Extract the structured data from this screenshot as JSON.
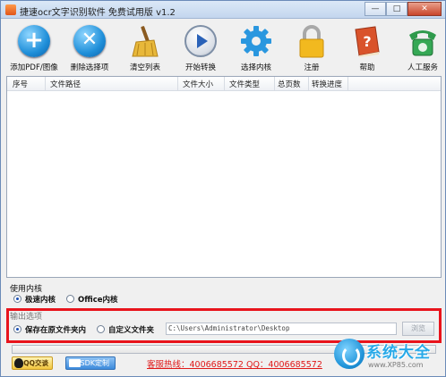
{
  "window": {
    "title": "捷速ocr文字识别软件 免费试用版 v1.2",
    "minimize_label": "—",
    "maximize_label": "□",
    "close_label": "✕"
  },
  "toolbar": {
    "items": [
      {
        "label": "添加PDF/图像",
        "icon": "add-icon",
        "color": "#1f8fd9"
      },
      {
        "label": "删除选择项",
        "icon": "delete-icon",
        "color": "#1f8fd9"
      },
      {
        "label": "清空列表",
        "icon": "broom-icon",
        "color": "#d4a12a"
      },
      {
        "label": "开始转换",
        "icon": "play-icon",
        "color": "#2a62b8"
      },
      {
        "label": "选择内核",
        "icon": "gear-icon",
        "color": "#1f8fd9"
      },
      {
        "label": "注册",
        "icon": "lock-icon",
        "color": "#f0b820"
      },
      {
        "label": "帮助",
        "icon": "help-book-icon",
        "color": "#d9532b"
      },
      {
        "label": "人工服务",
        "icon": "phone-icon",
        "color": "#2f9a4c"
      }
    ]
  },
  "table": {
    "columns": [
      "序号",
      "文件路径",
      "文件大小",
      "文件类型",
      "总页数",
      "转换进度"
    ],
    "rows": []
  },
  "core": {
    "title": "使用内核",
    "options": [
      {
        "label": "极速内核",
        "selected": true
      },
      {
        "label": "Office内核",
        "selected": false
      }
    ]
  },
  "output": {
    "title": "输出选项",
    "options": [
      {
        "label": "保存在原文件夹内",
        "selected": true
      },
      {
        "label": "自定义文件夹",
        "selected": false
      }
    ],
    "path": "C:\\Users\\Administrator\\Desktop",
    "browse_label": "浏览"
  },
  "bottom": {
    "qq_label": "QQ交谈",
    "sdk_label": "SDK定制",
    "hotline": "客服热线：4006685572 QQ：4006685572"
  },
  "watermark": {
    "title": "系统大全",
    "url": "www.XP85.com"
  }
}
